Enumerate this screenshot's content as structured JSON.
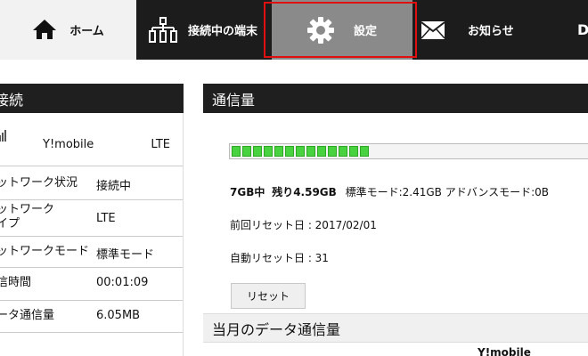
{
  "nav": {
    "home_label": "ホーム",
    "devices_label": "接続中の端末",
    "settings_label": "設定",
    "news_label": "お知らせ",
    "more_label": "D"
  },
  "left_panel": {
    "title": "接続",
    "carrier": "Y!mobile",
    "network_type": "LTE",
    "rows": [
      {
        "label": "ットワーク状況",
        "value": "接続中"
      },
      {
        "label": "ットワーク\nイプ",
        "value": "LTE"
      },
      {
        "label": "ットワークモード",
        "value": "標準モード"
      },
      {
        "label": "信時間",
        "value": "00:01:09"
      },
      {
        "label": "ータ通信量",
        "value": "6.05MB"
      }
    ]
  },
  "right_panel": {
    "title": "通信量",
    "usage_progress_percent": 36,
    "usage_total": "7GB中",
    "usage_remaining": "残り4.59GB",
    "usage_detail": "標準モード:2.41GB アドバンスモード:0B",
    "last_reset": "前回リセット日 : 2017/02/01",
    "auto_reset": "自動リセット日 : 31",
    "reset_button": "リセット",
    "monthly_title": "当月のデータ通信量",
    "monthly_column": "Y!mobile"
  }
}
